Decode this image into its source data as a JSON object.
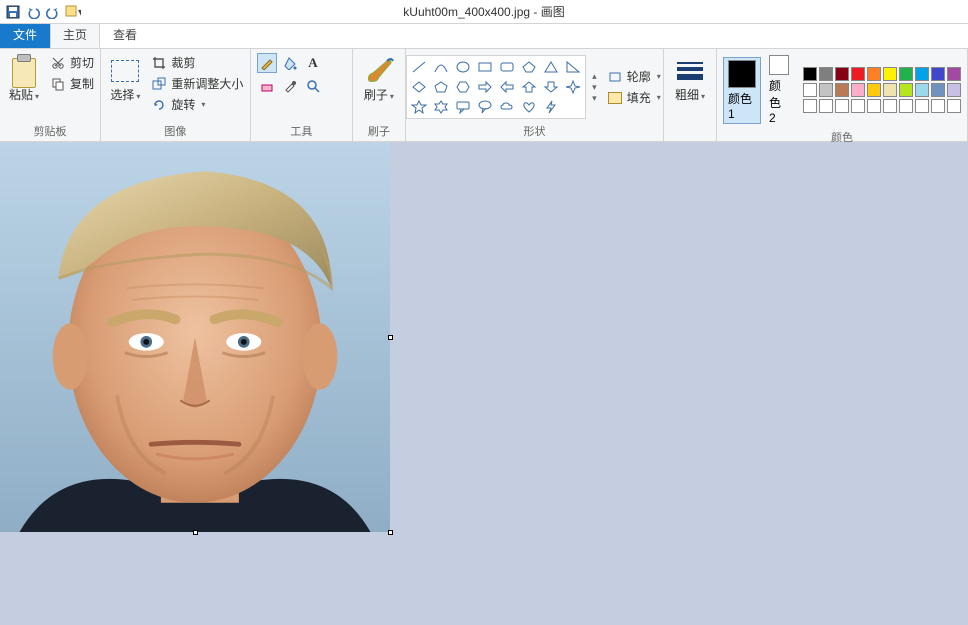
{
  "title": "kUuht00m_400x400.jpg - 画图",
  "tabs": {
    "file": "文件",
    "home": "主页",
    "view": "查看"
  },
  "groups": {
    "clipboard": {
      "label": "剪贴板",
      "paste": "粘贴",
      "cut": "剪切",
      "copy": "复制"
    },
    "image": {
      "label": "图像",
      "select": "选择",
      "crop": "裁剪",
      "resize": "重新调整大小",
      "rotate": "旋转"
    },
    "tools": {
      "label": "工具"
    },
    "brush": {
      "label": "刷子",
      "brush": "刷子"
    },
    "shapes": {
      "label": "形状",
      "outline": "轮廓",
      "fill": "填充"
    },
    "stroke": {
      "label": "粗细",
      "btn": "粗细"
    },
    "colors": {
      "label": "颜色",
      "color1": "颜色 1",
      "color2": "颜色 2"
    }
  },
  "palette": {
    "row1": [
      "#000000",
      "#7f7f7f",
      "#880015",
      "#ed1c24",
      "#ff7f27",
      "#fff200",
      "#22b14c",
      "#00a2e8",
      "#3f48cc",
      "#a349a4"
    ],
    "row2": [
      "#ffffff",
      "#c3c3c3",
      "#b97a57",
      "#ffaec9",
      "#ffc90e",
      "#efe4b0",
      "#b5e61d",
      "#99d9ea",
      "#7092be",
      "#c8bfe7"
    ],
    "row3": [
      "#ffffff",
      "#ffffff",
      "#ffffff",
      "#ffffff",
      "#ffffff",
      "#ffffff",
      "#ffffff",
      "#ffffff",
      "#ffffff",
      "#ffffff"
    ]
  },
  "image_content": "Photograph: close-up headshot of a man with a serious expression, blond/grey side-swept hair, fair skin, looking at camera; dark suit collar visible at bottom; pale blue background."
}
